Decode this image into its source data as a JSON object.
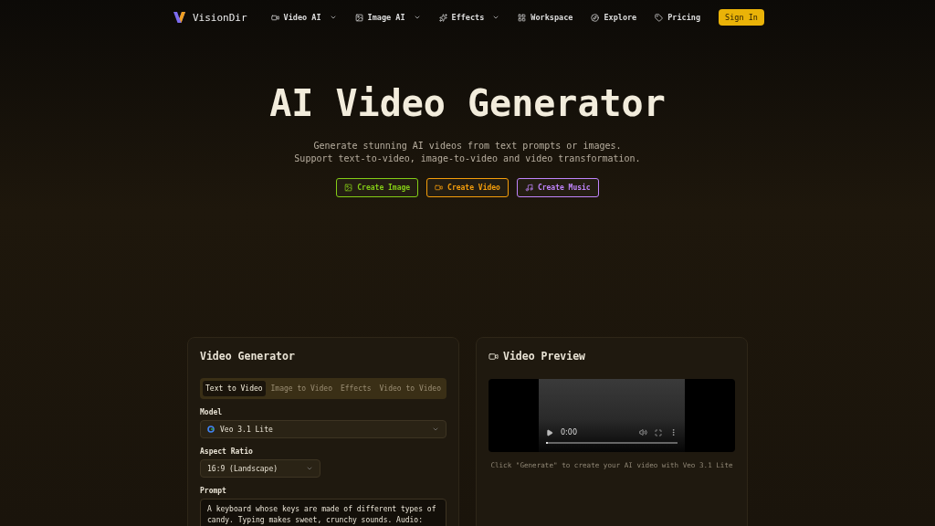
{
  "nav": {
    "brand": "VisionDir",
    "items": [
      {
        "label": "Video AI",
        "dropdown": true
      },
      {
        "label": "Image AI",
        "dropdown": true
      },
      {
        "label": "Effects",
        "dropdown": true
      },
      {
        "label": "Workspace",
        "dropdown": false
      },
      {
        "label": "Explore",
        "dropdown": false
      },
      {
        "label": "Pricing",
        "dropdown": false
      }
    ],
    "sign_in": "Sign In"
  },
  "hero": {
    "title": "AI Video Generator",
    "subtitle_lines": [
      "Generate stunning AI videos from text prompts or images.",
      "Support text-to-video, image-to-video and video transformation."
    ],
    "buttons": [
      {
        "label": "Create Image",
        "color": "#84cc16"
      },
      {
        "label": "Create Video",
        "color": "#f59e0b"
      },
      {
        "label": "Create Music",
        "color": "#c084fc"
      }
    ]
  },
  "generator": {
    "title": "Video Generator",
    "tabs": [
      {
        "label": "Text to Video",
        "selected": true
      },
      {
        "label": "Image to Video",
        "selected": false
      },
      {
        "label": "Effects",
        "selected": false
      },
      {
        "label": "Video to Video",
        "selected": false
      }
    ],
    "model_label": "Model",
    "model": "Veo 3.1 Lite",
    "aspect_label": "Aspect Ratio",
    "aspect": "16:9 (Landscape)",
    "prompt_label": "Prompt",
    "prompt": "A keyboard whose keys are made of different types of candy. Typing makes sweet, crunchy sounds. Audio:"
  },
  "preview": {
    "title": "Video Preview",
    "time": "0:00",
    "progress": {
      "level": 0
    },
    "hint": "Click \"Generate\" to create your AI video with Veo 3.1 Lite"
  }
}
